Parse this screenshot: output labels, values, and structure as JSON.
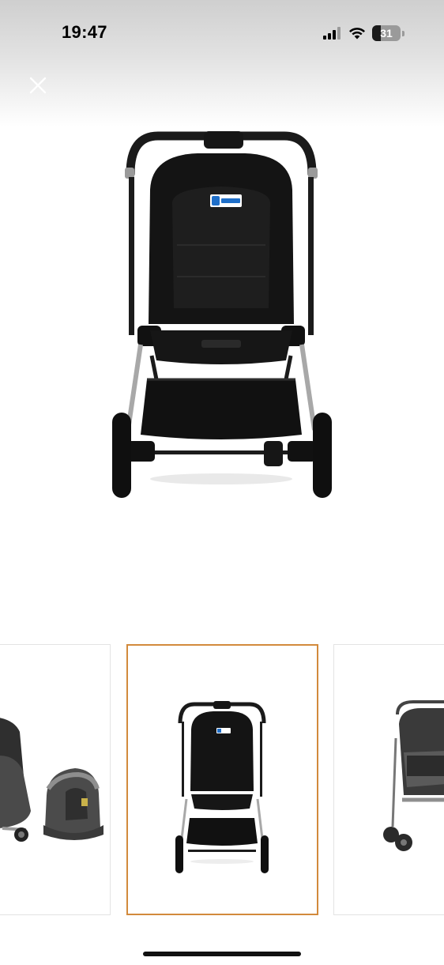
{
  "status_bar": {
    "time": "19:47",
    "battery_level": "31",
    "icons": [
      "cellular-signal-icon",
      "wifi-icon",
      "battery-icon"
    ]
  },
  "viewer": {
    "close_icon": "close-icon",
    "main_image": "stroller-front-view",
    "thumbnails": [
      {
        "image": "stroller-side-with-car-seat",
        "selected": false
      },
      {
        "image": "stroller-front-view",
        "selected": true
      },
      {
        "image": "stroller-side-view",
        "selected": false
      }
    ]
  },
  "colors": {
    "selected_border": "#d28a3c",
    "thumb_border": "#e3e3e3",
    "stroller_black": "#111111",
    "chrome": "#9a9a9a"
  }
}
